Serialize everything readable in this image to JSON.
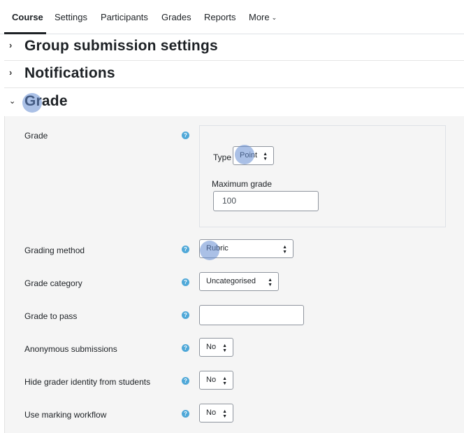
{
  "nav": {
    "items": [
      "Course",
      "Settings",
      "Participants",
      "Grades",
      "Reports",
      "More"
    ],
    "active": "Course"
  },
  "sections": {
    "group_submission": "Group submission settings",
    "notifications": "Notifications",
    "grade": "Grade"
  },
  "grade_form": {
    "grade_label": "Grade",
    "type_label": "Type",
    "type_value": "Point",
    "max_grade_label": "Maximum grade",
    "max_grade_value": "100",
    "grading_method_label": "Grading method",
    "grading_method_value": "Rubric",
    "grade_category_label": "Grade category",
    "grade_category_value": "Uncategorised",
    "grade_to_pass_label": "Grade to pass",
    "grade_to_pass_value": "",
    "anonymous_label": "Anonymous submissions",
    "anonymous_value": "No",
    "hide_grader_label": "Hide grader identity from students",
    "hide_grader_value": "No",
    "marking_workflow_label": "Use marking workflow",
    "marking_workflow_value": "No"
  },
  "icons": {
    "help": "question-circle-icon",
    "collapsed": "chevron-right-icon",
    "expanded": "chevron-down-icon",
    "select": "sort-arrows-icon"
  },
  "colors": {
    "help_icon": "#4fa8d8",
    "panel_bg": "#f5f5f5",
    "highlight": "#648cd2"
  }
}
